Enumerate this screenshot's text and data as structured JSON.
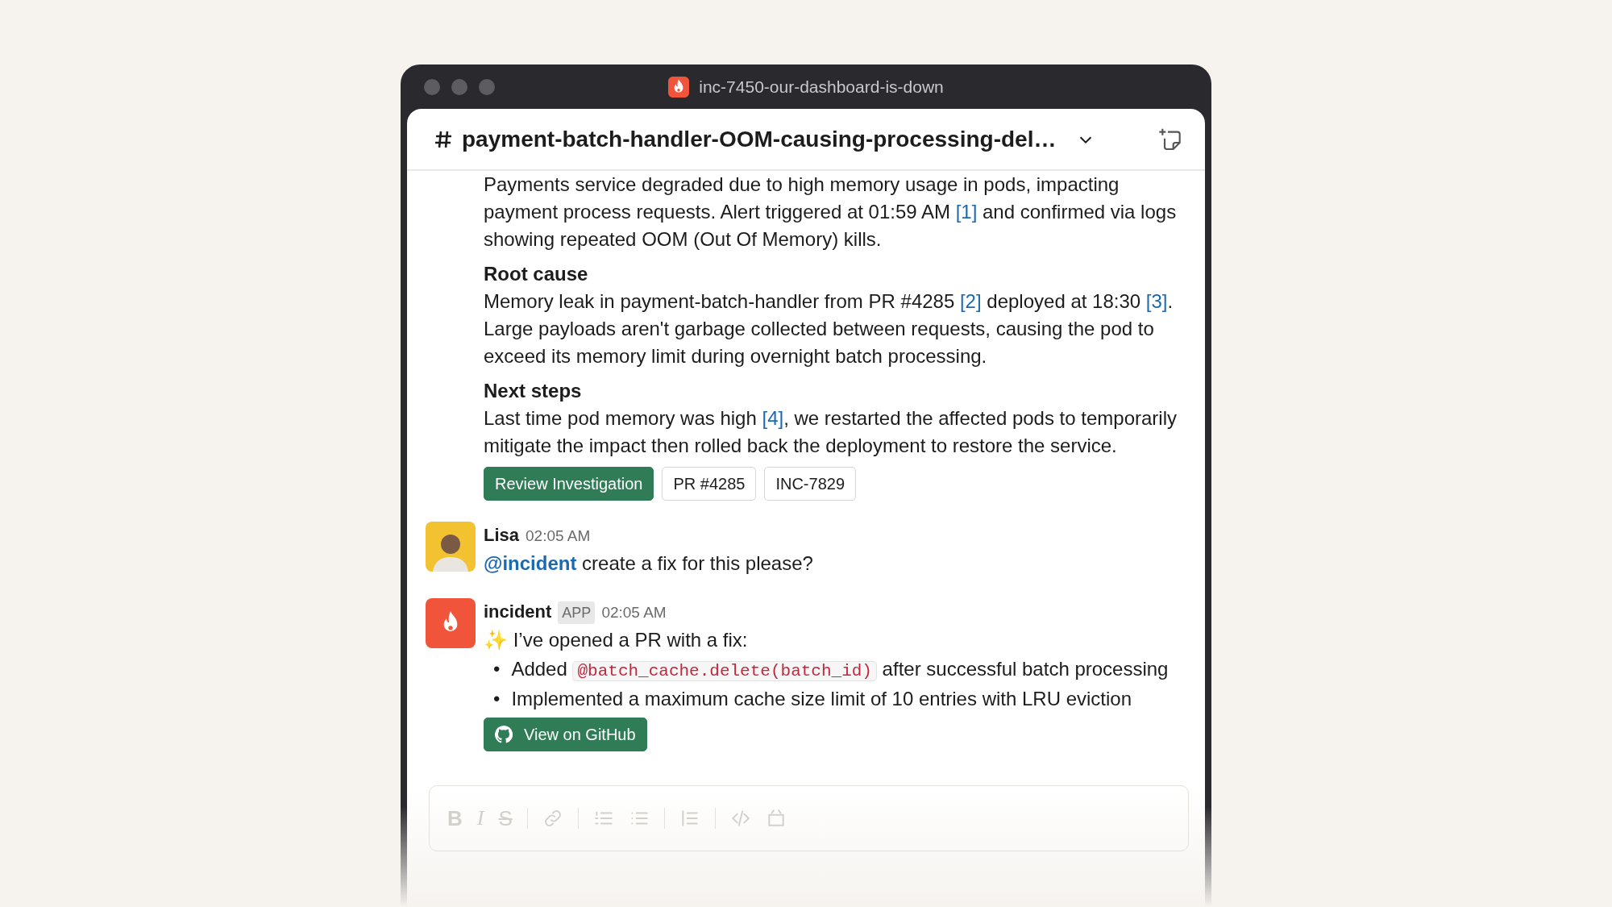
{
  "window": {
    "title": "inc-7450-our-dashboard-is-down"
  },
  "channel_header": {
    "title": "payment-batch-handler-OOM-causing-processing-del…"
  },
  "messages": [
    {
      "kind": "continuation",
      "sections": [
        {
          "body": [
            {
              "kind": "text",
              "text": "Payments service degraded due to high memory usage in pods, impacting payment process requests. Alert triggered at 01:59 AM "
            },
            {
              "kind": "link",
              "text": "[1]"
            },
            {
              "kind": "text",
              "text": " and confirmed via logs showing repeated OOM (Out Of Memory) kills."
            }
          ]
        },
        {
          "heading": "Root cause",
          "body": [
            {
              "kind": "text",
              "text": "Memory leak in payment-batch-handler from PR #4285 "
            },
            {
              "kind": "link",
              "text": "[2]"
            },
            {
              "kind": "text",
              "text": " deployed at 18:30 "
            },
            {
              "kind": "link",
              "text": "[3]"
            },
            {
              "kind": "text",
              "text": ". Large payloads aren't garbage collected between requests, causing the pod to exceed its memory limit during overnight batch processing."
            }
          ]
        },
        {
          "heading": "Next steps",
          "body": [
            {
              "kind": "text",
              "text": "Last time pod memory was high "
            },
            {
              "kind": "link",
              "text": "[4]"
            },
            {
              "kind": "text",
              "text": ", we restarted the affected pods to temporarily mitigate the impact then rolled back the deployment to restore the service."
            }
          ]
        }
      ],
      "buttons": [
        {
          "label": "Review Investigation",
          "primary": true
        },
        {
          "label": "PR #4285",
          "primary": false
        },
        {
          "label": "INC-7829",
          "primary": false
        }
      ]
    },
    {
      "kind": "user",
      "author": "Lisa",
      "time": "02:05 AM",
      "body": [
        {
          "kind": "mention",
          "text": "@incident"
        },
        {
          "kind": "text",
          "text": " create a fix for this please?"
        }
      ]
    },
    {
      "kind": "app",
      "author": "incident",
      "badge": "APP",
      "time": "02:05 AM",
      "body": [
        {
          "kind": "text",
          "text": "✨ I’ve opened a PR with a fix:"
        }
      ],
      "bullets": [
        {
          "marker": "•",
          "segments": [
            {
              "kind": "text",
              "text": "Added "
            },
            {
              "kind": "code",
              "text": "@batch_cache.delete(batch_id)"
            },
            {
              "kind": "text",
              "text": " after successful batch processing"
            }
          ]
        },
        {
          "marker": "•",
          "segments": [
            {
              "kind": "text",
              "text": "Implemented a maximum cache size limit of 10 entries with LRU eviction"
            }
          ]
        }
      ],
      "buttons": [
        {
          "label": "View on GitHub",
          "primary": true,
          "github_icon": true
        }
      ]
    }
  ],
  "composer": {
    "format_buttons": [
      {
        "label": "B"
      },
      {
        "label": "I"
      },
      {
        "label": "S"
      }
    ]
  }
}
